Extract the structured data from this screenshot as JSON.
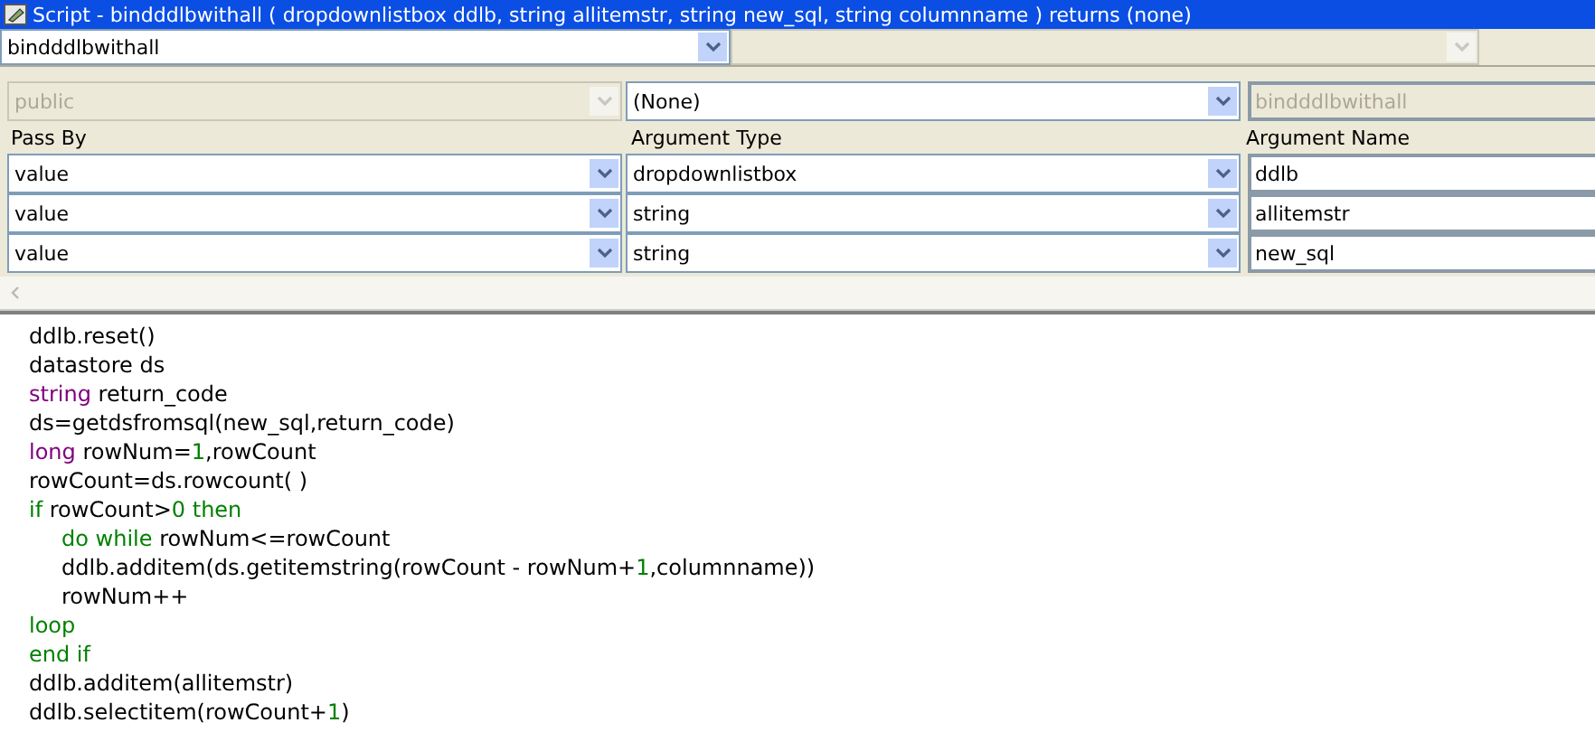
{
  "window": {
    "title": "Script - bindddlbwithall ( dropdownlistbox ddlb, string allitemstr, string new_sql, string columnname ) returns (none)"
  },
  "toolbar": {
    "object_select": {
      "value": "bindddlbwithall"
    },
    "event_select": {
      "disabled": true
    }
  },
  "signature": {
    "access": {
      "value": "public",
      "disabled": true
    },
    "return_type": {
      "value": "(None)",
      "disabled": false
    },
    "function_name": {
      "value": "bindddlbwithall",
      "disabled": true
    }
  },
  "arguments": {
    "columns": [
      "Pass By",
      "Argument Type",
      "Argument Name"
    ],
    "rows": [
      {
        "pass_by": "value",
        "type": "dropdownlistbox",
        "name": "ddlb"
      },
      {
        "pass_by": "value",
        "type": "string",
        "name": "allitemstr"
      },
      {
        "pass_by": "value",
        "type": "string",
        "name": "new_sql"
      }
    ]
  },
  "code": [
    {
      "indented": false,
      "tokens": [
        {
          "kind": "plain",
          "text": "ddlb.reset()"
        }
      ]
    },
    {
      "indented": false,
      "tokens": [
        {
          "kind": "plain",
          "text": "datastore ds"
        }
      ]
    },
    {
      "indented": false,
      "tokens": [
        {
          "kind": "type",
          "text": "string"
        },
        {
          "kind": "plain",
          "text": " return_code"
        }
      ]
    },
    {
      "indented": false,
      "tokens": [
        {
          "kind": "plain",
          "text": "ds=getdsfromsql(new_sql,return_code)"
        }
      ]
    },
    {
      "indented": false,
      "tokens": [
        {
          "kind": "type",
          "text": "long"
        },
        {
          "kind": "plain",
          "text": " rowNum="
        },
        {
          "kind": "number",
          "text": "1"
        },
        {
          "kind": "plain",
          "text": ",rowCount"
        }
      ]
    },
    {
      "indented": false,
      "tokens": [
        {
          "kind": "plain",
          "text": "rowCount=ds.rowcount( )"
        }
      ]
    },
    {
      "indented": false,
      "tokens": [
        {
          "kind": "keyword",
          "text": "if"
        },
        {
          "kind": "plain",
          "text": " rowCount>"
        },
        {
          "kind": "number",
          "text": "0"
        },
        {
          "kind": "keyword",
          "text": " then"
        }
      ]
    },
    {
      "indented": true,
      "tokens": [
        {
          "kind": "keyword",
          "text": "do while"
        },
        {
          "kind": "plain",
          "text": " rowNum<=rowCount"
        }
      ]
    },
    {
      "indented": true,
      "tokens": [
        {
          "kind": "plain",
          "text": "ddlb.additem(ds.getitemstring(rowCount - rowNum+"
        },
        {
          "kind": "number",
          "text": "1"
        },
        {
          "kind": "plain",
          "text": ",columnname))"
        }
      ]
    },
    {
      "indented": true,
      "tokens": [
        {
          "kind": "plain",
          "text": "rowNum++"
        }
      ]
    },
    {
      "indented": false,
      "tokens": [
        {
          "kind": "keyword",
          "text": "loop"
        }
      ]
    },
    {
      "indented": false,
      "tokens": [
        {
          "kind": "keyword",
          "text": "end if"
        }
      ]
    },
    {
      "indented": false,
      "tokens": [
        {
          "kind": "plain",
          "text": "ddlb.additem(allitemstr)"
        }
      ]
    },
    {
      "indented": false,
      "tokens": [
        {
          "kind": "plain",
          "text": "ddlb.selectitem(rowCount+"
        },
        {
          "kind": "number",
          "text": "1"
        },
        {
          "kind": "plain",
          "text": ")"
        }
      ]
    }
  ]
}
